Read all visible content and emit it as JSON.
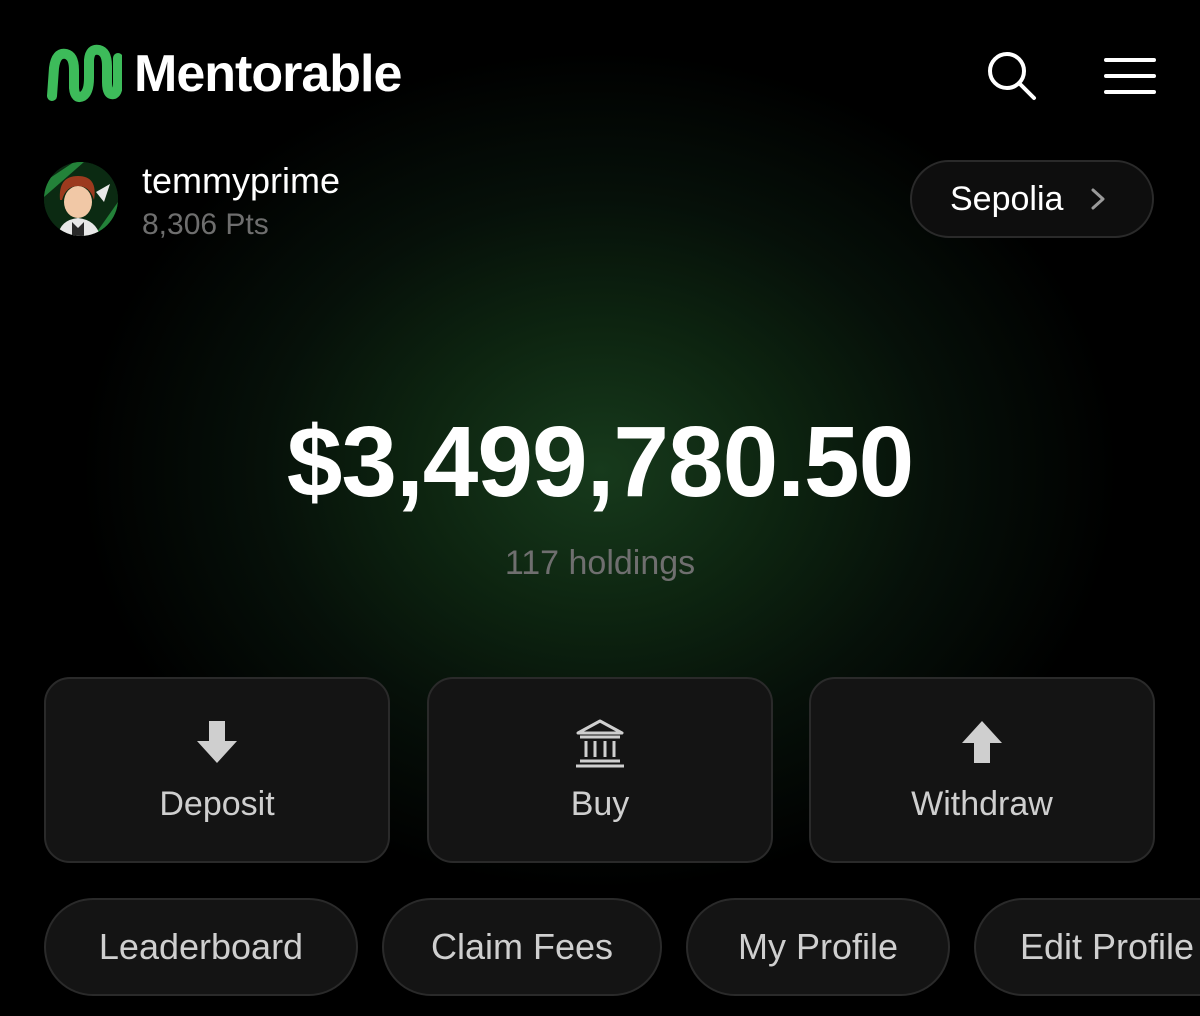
{
  "app": {
    "brand_name": "Mentorable",
    "accent_color": "#3dbb5a"
  },
  "header": {
    "search_icon": "search-icon",
    "menu_icon": "hamburger-menu-icon"
  },
  "user": {
    "username": "temmyprime",
    "points": "8,306 Pts"
  },
  "network": {
    "label": "Sepolia"
  },
  "portfolio": {
    "balance": "$3,499,780.50",
    "holdings": "117 holdings"
  },
  "actions": [
    {
      "label": "Deposit",
      "icon": "arrow-down-icon"
    },
    {
      "label": "Buy",
      "icon": "bank-icon"
    },
    {
      "label": "Withdraw",
      "icon": "arrow-up-icon"
    }
  ],
  "quick_links": [
    {
      "label": "Leaderboard"
    },
    {
      "label": "Claim Fees"
    },
    {
      "label": "My Profile"
    },
    {
      "label": "Edit Profile"
    }
  ]
}
